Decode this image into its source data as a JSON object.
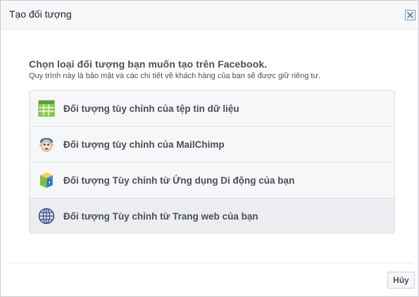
{
  "dialog": {
    "title": "Tạo đối tượng",
    "close_icon": "close-icon"
  },
  "intro": {
    "title": "Chọn loại đối tượng bạn muốn tạo trên Facebook.",
    "subtitle": "Quy trình này là bảo mật và các chi tiết về khách hàng của bạn sẽ được giữ riêng tư."
  },
  "options": [
    {
      "label": "Đối tượng tùy chỉnh của tệp tin dữ liệu",
      "icon": "spreadsheet-icon"
    },
    {
      "label": "Đối tượng tùy chỉnh của MailChimp",
      "icon": "mailchimp-icon"
    },
    {
      "label": "Đối tượng Tùy chỉnh từ Ứng dụng Di động của bạn",
      "icon": "mobile-app-icon"
    },
    {
      "label": "Đối tượng Tùy chỉnh từ Trang web của bạn",
      "icon": "globe-icon"
    }
  ],
  "footer": {
    "cancel_label": "Hủy"
  },
  "colors": {
    "header_bg": "#f6f7f9",
    "option_bg": "#f6f7f9",
    "option_hover_bg": "#ebedf0",
    "text": "#4b4f56"
  }
}
